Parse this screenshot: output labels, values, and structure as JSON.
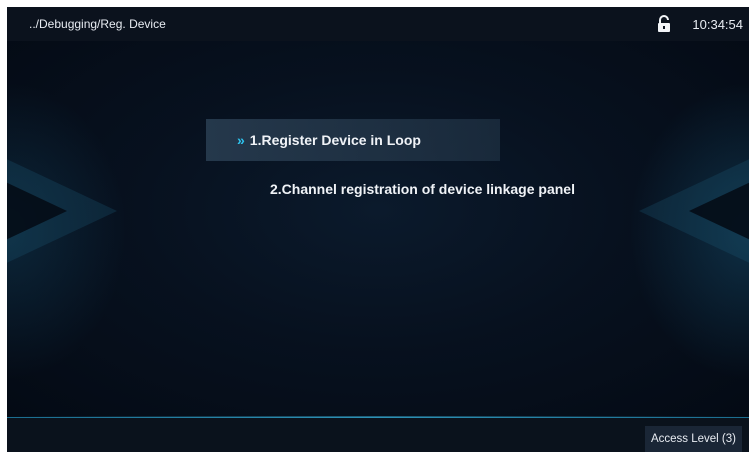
{
  "header": {
    "breadcrumb": "../Debugging/Reg. Device",
    "lock_icon": "unlocked-padlock-icon",
    "time": "10:34:54"
  },
  "menu": {
    "items": [
      {
        "label": "1.Register Device in Loop",
        "selected": true,
        "marker": "»"
      },
      {
        "label": "2.Channel registration of device linkage panel",
        "selected": false
      }
    ]
  },
  "footer": {
    "access_level": "Access Level  (3)"
  },
  "colors": {
    "accent": "#2ec5f0",
    "background": "#050c18"
  }
}
